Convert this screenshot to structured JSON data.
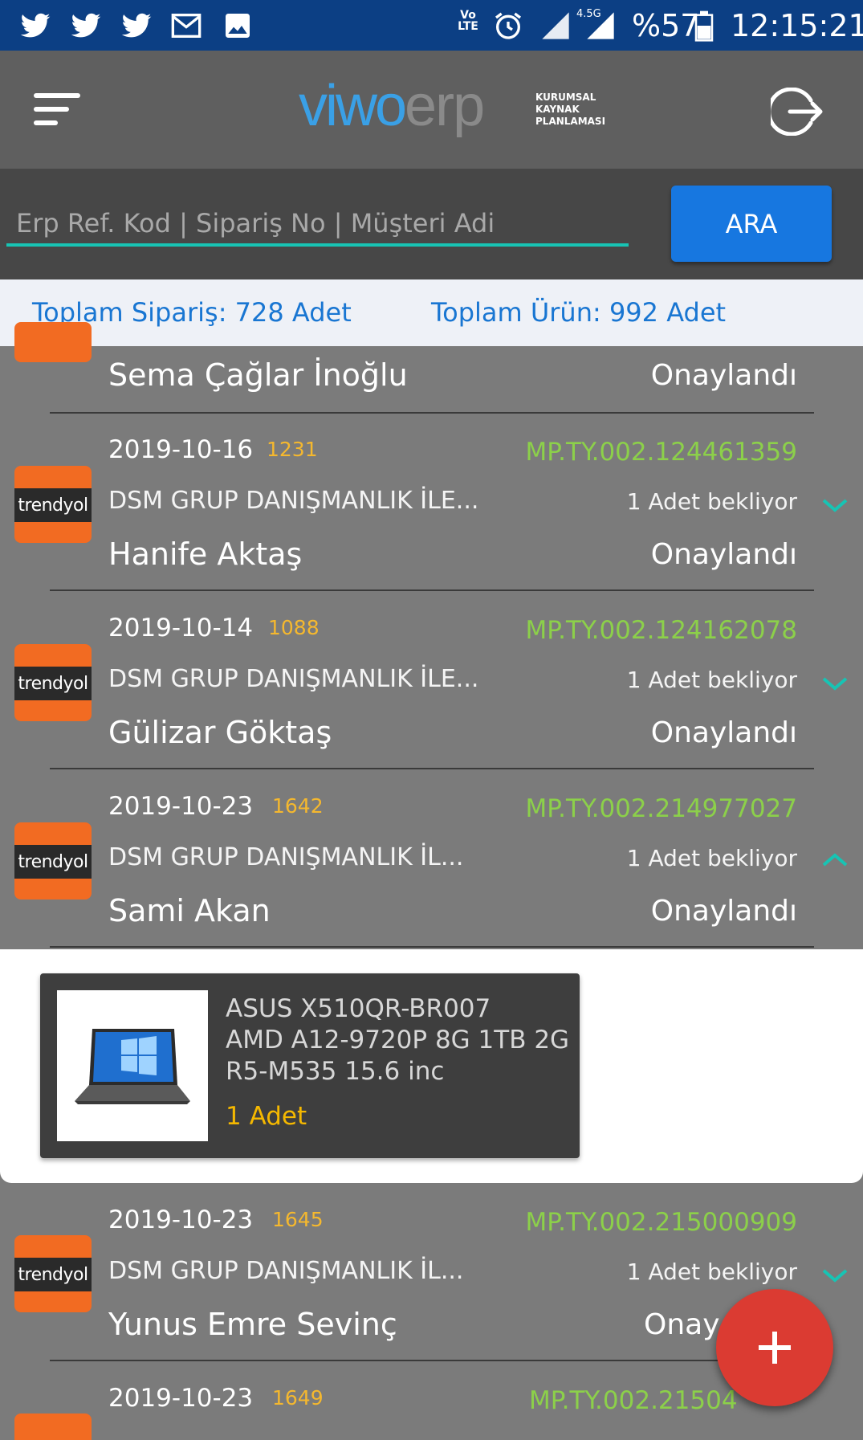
{
  "status_bar": {
    "battery": "%57",
    "time": "12:15:21",
    "network": "4.5G",
    "volte": "Vo LTE",
    "icons": [
      "twitter-icon",
      "twitter-icon",
      "twitter-icon",
      "gmail-icon",
      "image-icon",
      "volte-icon",
      "alarm-icon",
      "signal-icon",
      "signal-icon",
      "battery-icon"
    ]
  },
  "header": {
    "logo_text": "viwo",
    "logo_erp": "erp",
    "tagline": [
      "KURUMSAL",
      "KAYNAK",
      "PLANLAMASI"
    ],
    "menu_icon": "hamburger-menu-icon",
    "logout_icon": "logout-icon"
  },
  "search": {
    "placeholder": "Erp Ref. Kod | Sipariş No | Müşteri Adi",
    "value": "",
    "button_label": "ARA"
  },
  "summary": {
    "total_orders": "Toplam Sipariş: 728 Adet",
    "total_products": "Toplam Ürün: 992 Adet"
  },
  "orders": [
    {
      "customer": "Sema Çağlar İnoğlu",
      "status": "Onaylandı"
    },
    {
      "date": "2019-10-16",
      "number": "1231",
      "ref": "MP.TY.002.124461359",
      "company": "DSM GRUP DANIŞMANLIK İLE...",
      "pending": "1 Adet bekliyor",
      "customer": "Hanife  Aktaş",
      "status": "Onaylandı",
      "logo": "trendyol",
      "expanded": false
    },
    {
      "date": "2019-10-14",
      "number": "1088",
      "ref": "MP.TY.002.124162078",
      "company": "DSM GRUP DANIŞMANLIK İLE...",
      "pending": "1 Adet bekliyor",
      "customer": "Gülizar Göktaş",
      "status": "Onaylandı",
      "logo": "trendyol",
      "expanded": false
    },
    {
      "date": "2019-10-23",
      "number": "1642",
      "ref": "MP.TY.002.214977027",
      "company": "DSM GRUP DANIŞMANLIK İL...",
      "pending": "1 Adet bekliyor",
      "customer": "Sami Akan",
      "status": "Onaylandı",
      "logo": "trendyol",
      "expanded": true
    },
    {
      "date": "2019-10-23",
      "number": "1645",
      "ref": "MP.TY.002.215000909",
      "company": "DSM GRUP DANIŞMANLIK İL...",
      "pending": "1 Adet bekliyor",
      "customer": "Yunus Emre  Sevinç",
      "status": "Onay",
      "logo": "trendyol",
      "expanded": false
    },
    {
      "date": "2019-10-23",
      "number": "1649",
      "ref": "MP.TY.002.21504",
      "logo": "trendyol"
    }
  ],
  "expanded_product": {
    "name_lines": [
      "ASUS X510QR-BR007",
      "AMD A12-9720P 8G 1TB 2G",
      "R5-M535 15.6 inc"
    ],
    "quantity": "1 Adet"
  },
  "logo_label": "trendyol",
  "fab_icon": "plus-icon",
  "colors": {
    "status_bar": "#0c3f84",
    "ref_green": "#8cd04a",
    "order_number": "#f5b82e",
    "accent_blue": "#1777e0",
    "fab_red": "#db3b32",
    "chevron_teal": "#17c4b4",
    "brand_orange": "#f26b22"
  }
}
